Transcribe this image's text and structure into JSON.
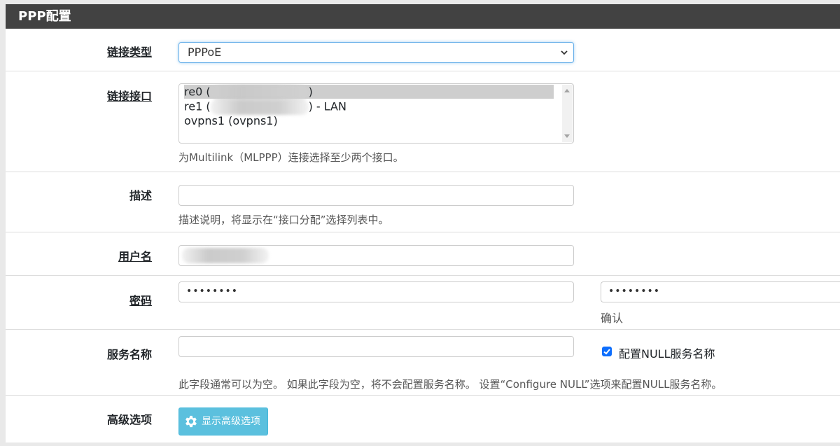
{
  "panel": {
    "title": "PPP配置"
  },
  "link_type": {
    "label": "链接类型",
    "value": "PPPoE"
  },
  "link_interface": {
    "label": "链接接口",
    "options": [
      {
        "prefix": "re0 (",
        "suffix": ")"
      },
      {
        "prefix": "re1 (",
        "suffix": ") - LAN"
      },
      {
        "text": "ovpns1 (ovpns1)"
      }
    ],
    "help": "为Multilink（MLPPP）连接选择至少两个接口。"
  },
  "description": {
    "label": "描述",
    "value": "",
    "help": "描述说明，将显示在“接口分配”选择列表中。"
  },
  "username": {
    "label": "用户名"
  },
  "password": {
    "label": "密码",
    "value": "••••••••",
    "confirm_value": "••••••••",
    "confirm_label": "确认"
  },
  "service_name": {
    "label": "服务名称",
    "value": "",
    "null_checkbox_label": "配置NULL服务名称",
    "null_checked": true,
    "help": "此字段通常可以为空。 如果此字段为空，将不会配置服务名称。 设置“Configure NULL”选项来配置NULL服务名称。"
  },
  "advanced": {
    "label": "高级选项",
    "button_label": "显示高级选项"
  },
  "colors": {
    "header_bg": "#424242",
    "button_bg": "#5bc0de",
    "checkbox": "#0d6efd"
  }
}
